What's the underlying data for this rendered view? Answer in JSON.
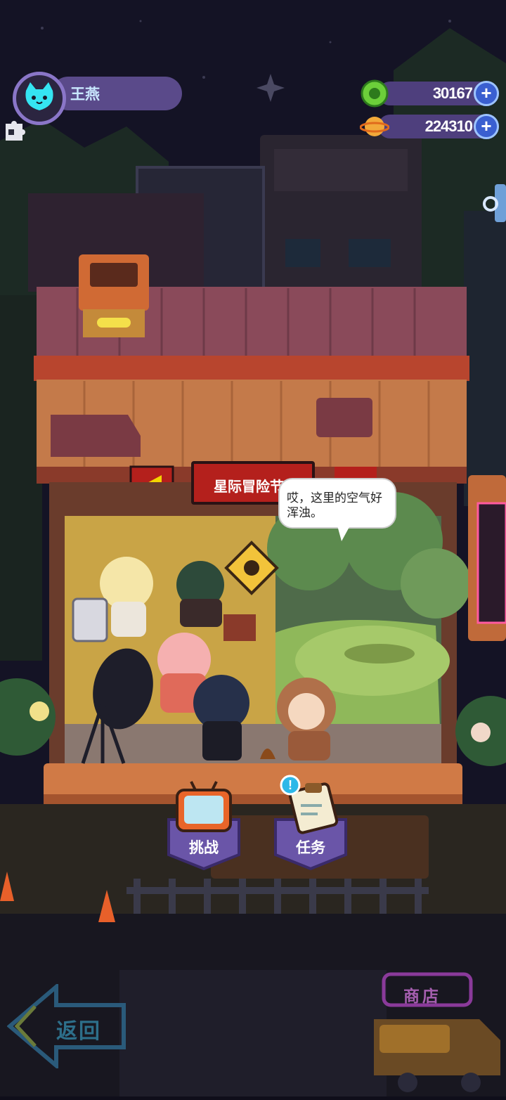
{
  "player": {
    "name": "王燕"
  },
  "currencies": [
    {
      "amount": "30167",
      "icon": "green-coin-icon",
      "add_label": "+"
    },
    {
      "amount": "224310",
      "icon": "planet-coin-icon",
      "add_label": "+"
    }
  ],
  "stage": {
    "title": "星际冒险节"
  },
  "dialogue": {
    "text": "哎，这里的空气好浑浊。"
  },
  "actions": [
    {
      "label": "挑战",
      "icon": "tv-icon"
    },
    {
      "label": "任务",
      "icon": "task-clipboard-icon",
      "badge": "!"
    }
  ],
  "nav": {
    "back_label": "返回",
    "shop_label": "商店"
  },
  "colors": {
    "accent": "#6a55a8",
    "sign_red": "#b4201c",
    "neon_cyan": "#2d6f8a",
    "neon_pink": "#a65fb0"
  }
}
